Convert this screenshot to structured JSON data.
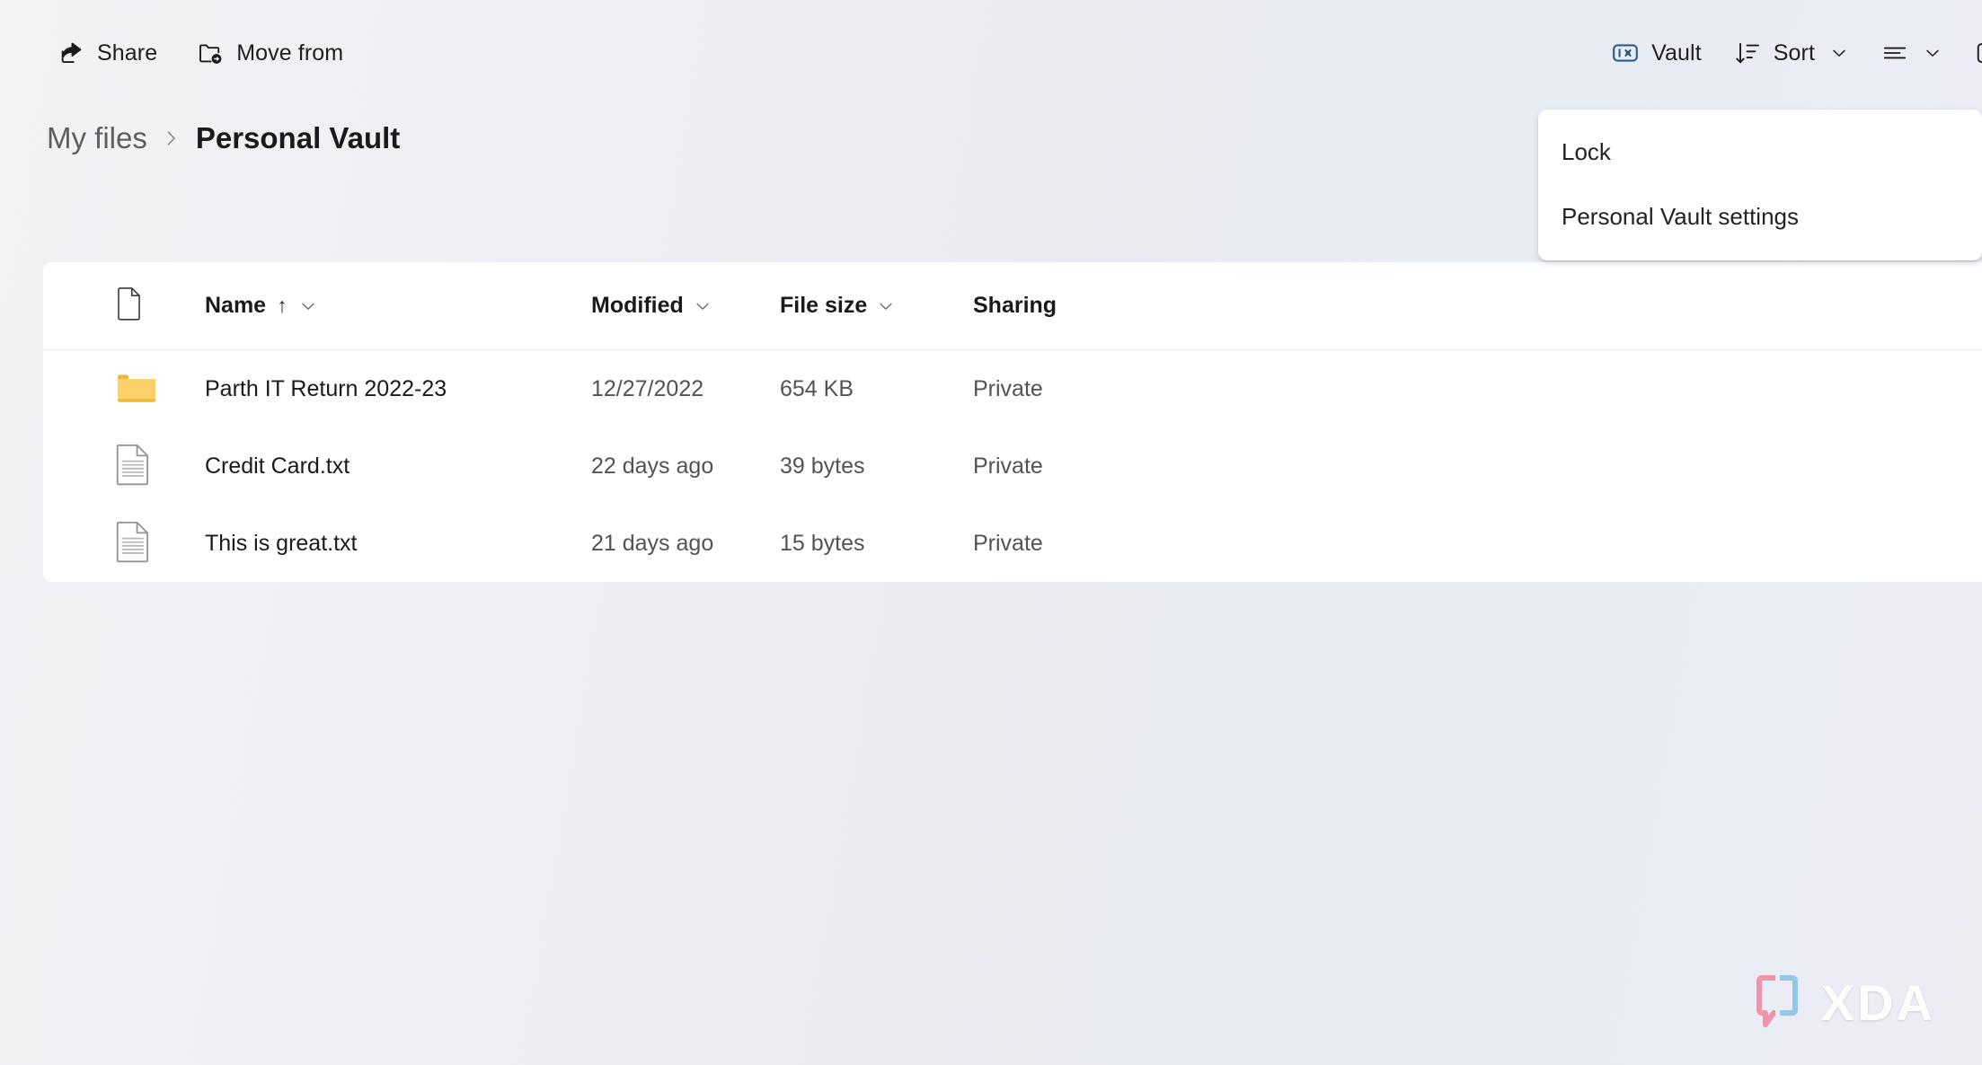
{
  "commandbar": {
    "left_actions": [
      {
        "label": "Share",
        "icon": "share-icon"
      },
      {
        "label": "Move from",
        "icon": "move-from-folder-icon"
      }
    ],
    "right_actions": [
      {
        "label": "Vault",
        "icon": "vault-icon",
        "has_chevron": false
      },
      {
        "label": "Sort",
        "icon": "sort-descending-icon",
        "has_chevron": true
      },
      {
        "label": "",
        "icon": "view-list-icon",
        "has_chevron": true
      },
      {
        "label": "",
        "icon": "info-panel-icon",
        "has_chevron": false
      }
    ]
  },
  "breadcrumb": {
    "root": "My files",
    "separator": "›",
    "current": "Personal Vault"
  },
  "vault_menu": {
    "items": [
      {
        "label": "Lock"
      },
      {
        "label": "Personal Vault settings"
      }
    ]
  },
  "filelist": {
    "columns": {
      "icon_header": "file-type-icon",
      "name": "Name",
      "sort_indicator": "↑",
      "modified": "Modified",
      "filesize": "File size",
      "sharing": "Sharing"
    },
    "rows": [
      {
        "icon": "folder-icon",
        "name": "Parth IT Return 2022-23",
        "modified": "12/27/2022",
        "filesize": "654 KB",
        "sharing": "Private"
      },
      {
        "icon": "text-file-icon",
        "name": "Credit Card.txt",
        "modified": "22 days ago",
        "filesize": "39 bytes",
        "sharing": "Private"
      },
      {
        "icon": "text-file-icon",
        "name": "This is great.txt",
        "modified": "21 days ago",
        "filesize": "15 bytes",
        "sharing": "Private"
      }
    ]
  },
  "watermark": {
    "text": "XDA",
    "bracket_left_color": "#ef8ea4",
    "bracket_right_color": "#8ec4e8"
  },
  "colors": {
    "accent": "#0f6cbd",
    "vault_icon": "#2c5a87",
    "folder": "#fbd168",
    "card_background": "#ffffff",
    "page_background": "#eeeef3"
  }
}
